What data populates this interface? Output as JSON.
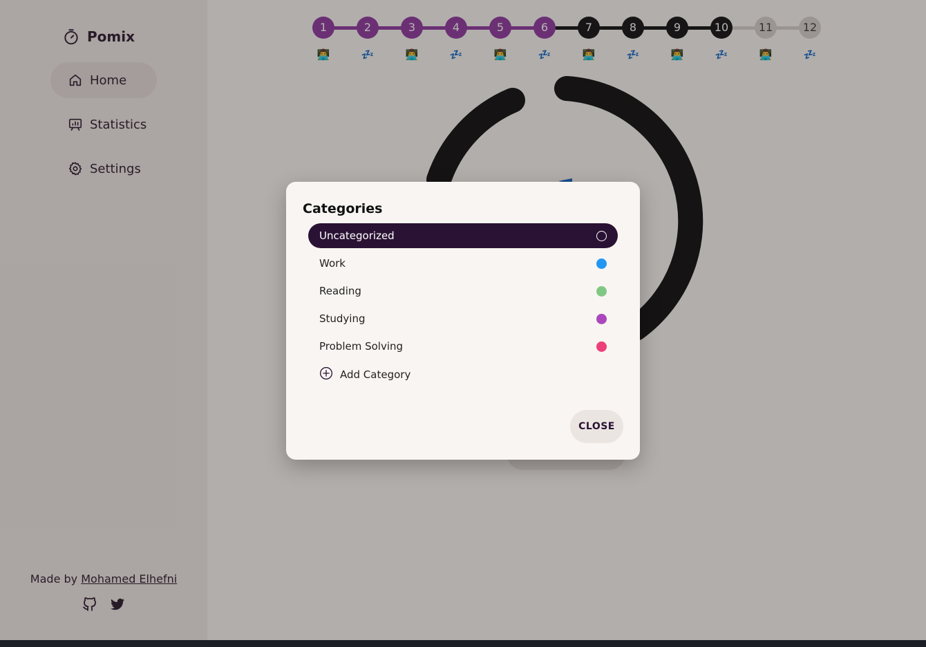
{
  "app": {
    "brand": "Pomix"
  },
  "sidebar": {
    "items": [
      {
        "label": "Home",
        "icon": "home-icon",
        "active": true
      },
      {
        "label": "Statistics",
        "icon": "statistics-icon",
        "active": false
      },
      {
        "label": "Settings",
        "icon": "settings-icon",
        "active": false
      }
    ],
    "credit_prefix": "Made by",
    "credit_author": "Mohamed Elhefni",
    "social": [
      "github-icon",
      "twitter-icon"
    ]
  },
  "steps": [
    {
      "number": "1",
      "status": "done",
      "type": "work",
      "emoji": "👨‍💻"
    },
    {
      "number": "2",
      "status": "done",
      "type": "break",
      "emoji": "💤"
    },
    {
      "number": "3",
      "status": "done",
      "type": "work",
      "emoji": "👨‍💻"
    },
    {
      "number": "4",
      "status": "done",
      "type": "break",
      "emoji": "💤"
    },
    {
      "number": "5",
      "status": "done",
      "type": "work",
      "emoji": "👨‍💻"
    },
    {
      "number": "6",
      "status": "done",
      "type": "break",
      "emoji": "💤"
    },
    {
      "number": "7",
      "status": "current",
      "type": "work",
      "emoji": "👨‍💻"
    },
    {
      "number": "8",
      "status": "current",
      "type": "break",
      "emoji": "💤"
    },
    {
      "number": "9",
      "status": "current",
      "type": "work",
      "emoji": "👨‍💻"
    },
    {
      "number": "10",
      "status": "current",
      "type": "break",
      "emoji": "💤"
    },
    {
      "number": "11",
      "status": "pending",
      "type": "work",
      "emoji": "👨‍💻"
    },
    {
      "number": "12",
      "status": "pending",
      "type": "break",
      "emoji": "💤"
    }
  ],
  "modal": {
    "title": "Categories",
    "categories": [
      {
        "label": "Uncategorized",
        "color": "#2a1234",
        "selected": true
      },
      {
        "label": "Work",
        "color": "#2196f3",
        "selected": false
      },
      {
        "label": "Reading",
        "color": "#81c784",
        "selected": false
      },
      {
        "label": "Studying",
        "color": "#ab47bc",
        "selected": false
      },
      {
        "label": "Problem Solving",
        "color": "#ec407a",
        "selected": false
      }
    ],
    "add_label": "Add Category",
    "close_label": "CLOSE"
  },
  "colors": {
    "done": "#8e3a9e",
    "current": "#111111",
    "pending": "#d4cfcc"
  }
}
